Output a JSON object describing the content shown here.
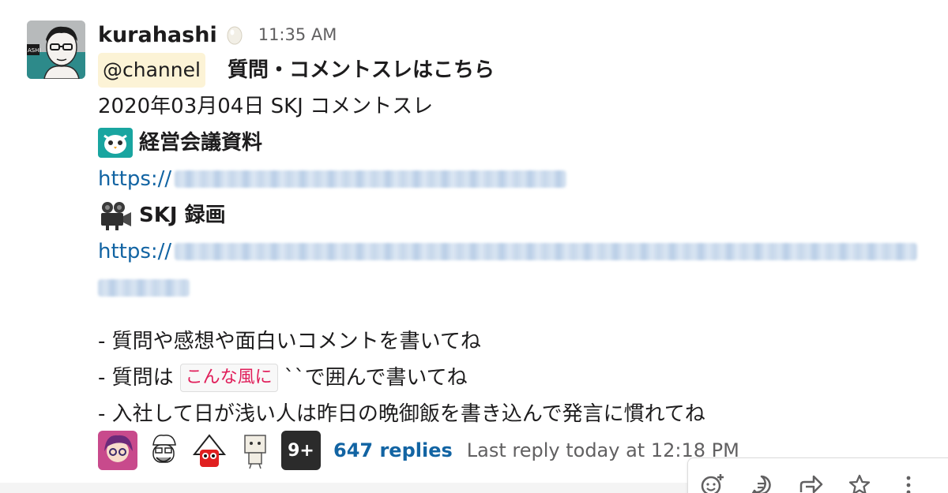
{
  "message": {
    "username": "kurahashi",
    "timestamp": "11:35 AM",
    "mention": "@channel",
    "title": "質問・コメントスレはこちら",
    "date_line": "2020年03月04日 SKJ コメントスレ",
    "section1_title": "経営会議資料",
    "section1_link_prefix": "https://",
    "section2_title": "SKJ 録画",
    "section2_link_prefix": "https://",
    "bullet1": "- 質問や感想や面白いコメントを書いてね",
    "bullet2_prefix": "- 質問は",
    "bullet2_code": "こんな風に",
    "bullet2_suffix": "``で囲んで書いてね",
    "bullet3": "- 入社して日が浅い人は昨日の晩御飯を書き込んで発言に慣れてね",
    "avatar_badge": "ASHI"
  },
  "thread": {
    "more_avatars": "9+",
    "reply_count": "647 replies",
    "last_reply": "Last reply today at 12:18 PM"
  },
  "toolbar": {
    "icons": [
      "add-reaction-icon",
      "reply-in-thread-icon",
      "share-icon",
      "star-icon",
      "more-actions-icon"
    ]
  },
  "colors": {
    "link": "#1264a3",
    "mention_bg": "#fcf3d6",
    "code_text": "#e01e5a",
    "muted_text": "#616061"
  }
}
